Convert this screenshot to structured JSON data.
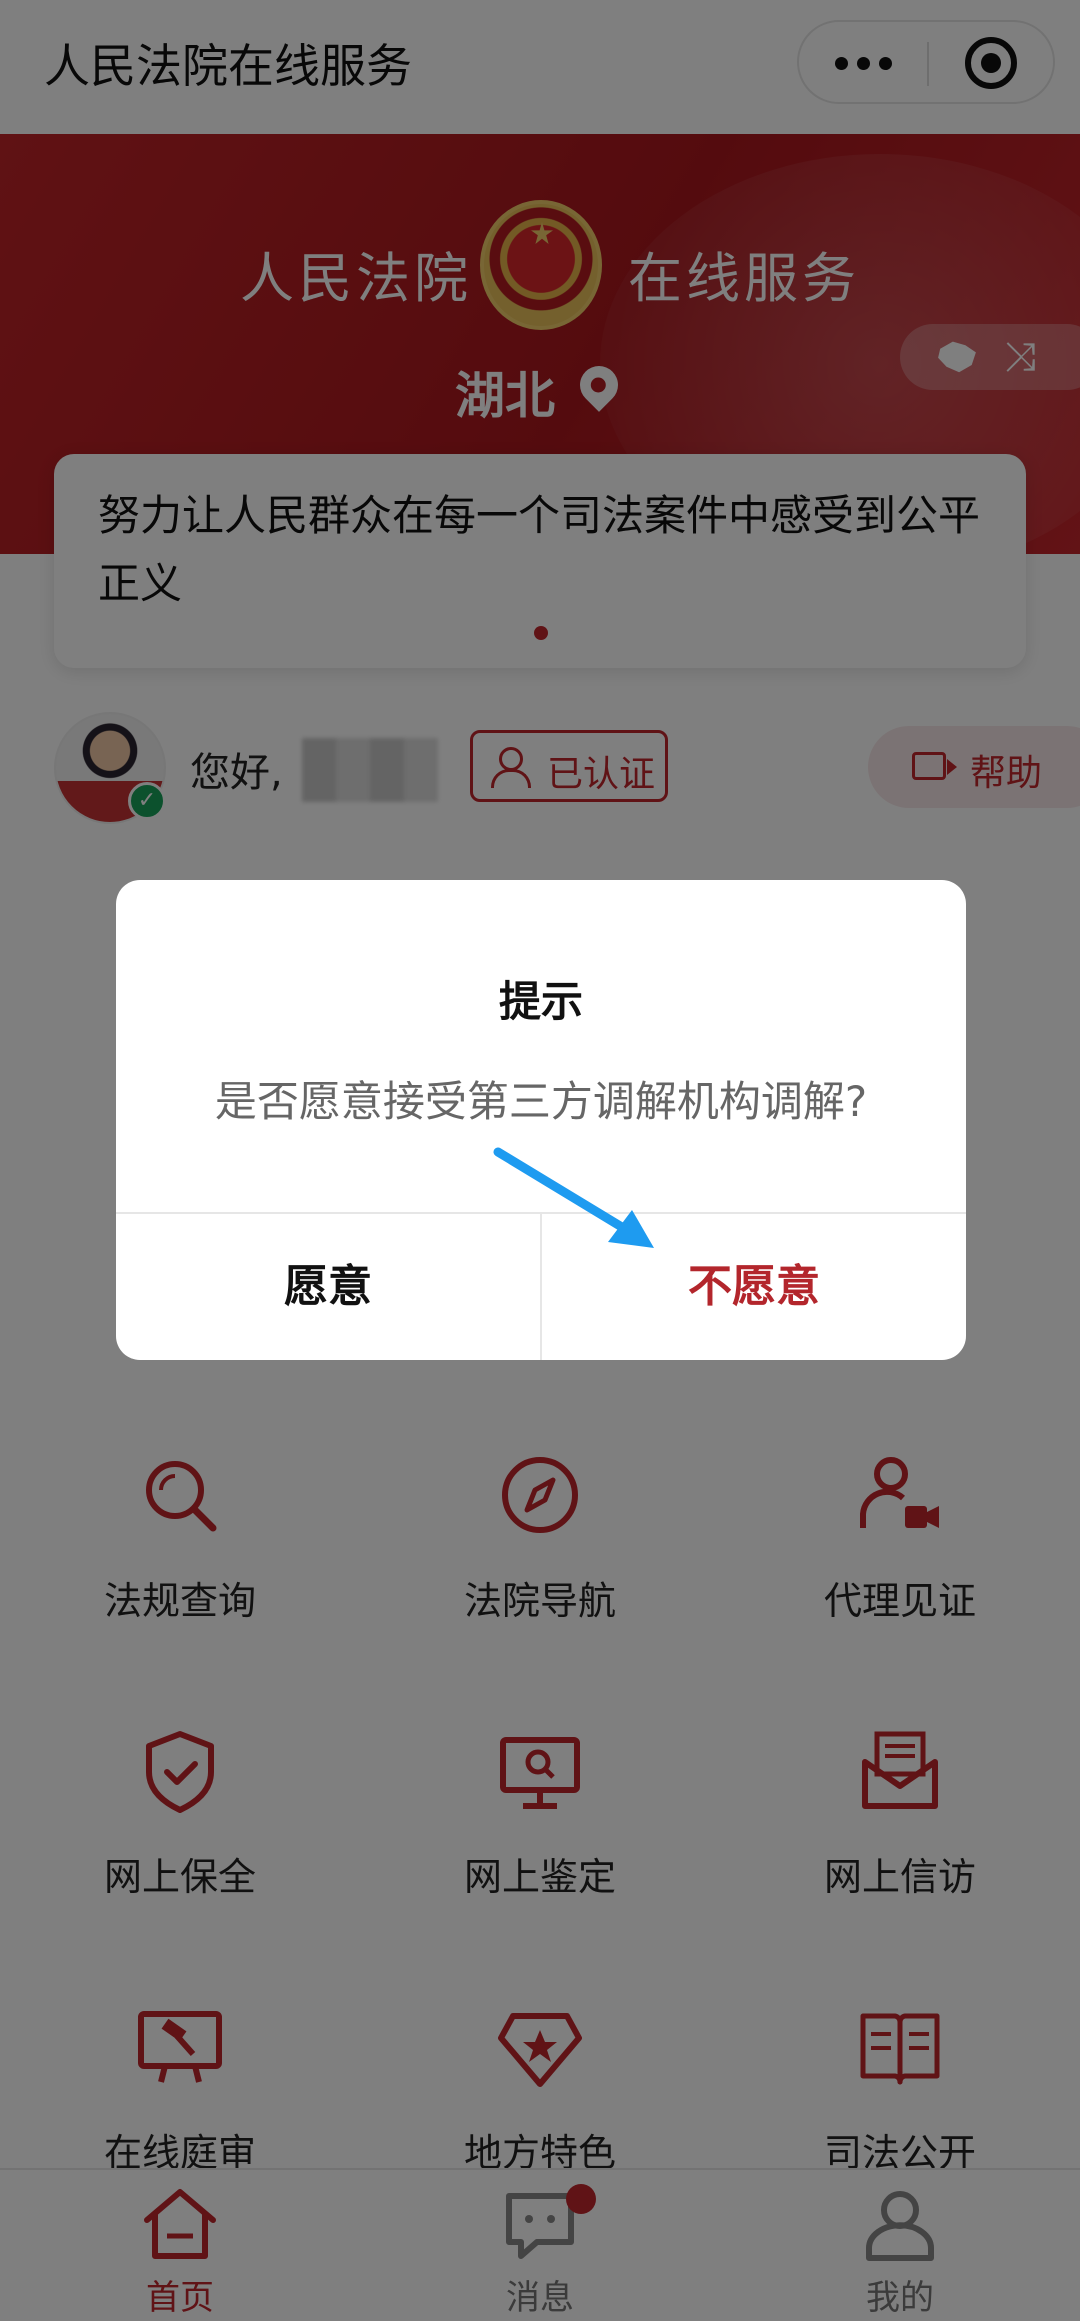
{
  "app": {
    "title": "人民法院在线服务"
  },
  "banner": {
    "title_left": "人民法院",
    "title_right": "在线服务",
    "province": "湖北"
  },
  "notice": {
    "text": "努力让人民群众在每一个司法案件中感受到公平正义"
  },
  "user": {
    "greeting": "您好,",
    "auth_label": "已认证",
    "help_label": "帮助"
  },
  "services": [
    {
      "label": "法规查询",
      "icon": "search-icon"
    },
    {
      "label": "法院导航",
      "icon": "compass-icon"
    },
    {
      "label": "代理见证",
      "icon": "video-witness-icon"
    },
    {
      "label": "网上保全",
      "icon": "shield-check-icon"
    },
    {
      "label": "网上鉴定",
      "icon": "monitor-search-icon"
    },
    {
      "label": "网上信访",
      "icon": "letter-icon"
    },
    {
      "label": "在线庭审",
      "icon": "gavel-screen-icon"
    },
    {
      "label": "地方特色",
      "icon": "star-badge-icon"
    },
    {
      "label": "司法公开",
      "icon": "open-book-icon"
    }
  ],
  "tabbar": {
    "items": [
      {
        "label": "首页",
        "icon": "home-icon",
        "active": true
      },
      {
        "label": "消息",
        "icon": "message-icon",
        "active": false
      },
      {
        "label": "我的",
        "icon": "user-icon",
        "active": false
      }
    ]
  },
  "dialog": {
    "title": "提示",
    "message": "是否愿意接受第三方调解机构调解?",
    "accept_label": "愿意",
    "decline_label": "不愿意"
  },
  "colors": {
    "brand_red": "#c1272d",
    "decline_red": "#b3262c",
    "arrow_blue": "#1e9bf0"
  }
}
